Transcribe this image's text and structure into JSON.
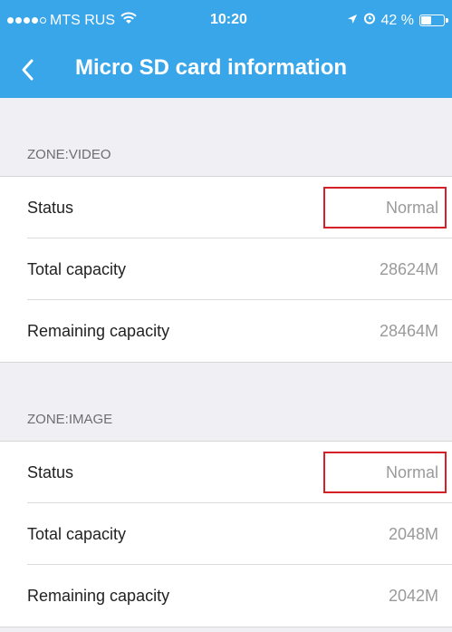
{
  "status_bar": {
    "carrier": "MTS RUS",
    "time": "10:20",
    "battery": "42 %",
    "battery_level": 0.42
  },
  "nav": {
    "title": "Micro SD card information"
  },
  "sections": [
    {
      "header": "ZONE:VIDEO",
      "rows": [
        {
          "label": "Status",
          "value": "Normal"
        },
        {
          "label": "Total capacity",
          "value": "28624M"
        },
        {
          "label": "Remaining capacity",
          "value": "28464M"
        }
      ]
    },
    {
      "header": "ZONE:IMAGE",
      "rows": [
        {
          "label": "Status",
          "value": "Normal"
        },
        {
          "label": "Total capacity",
          "value": "2048M"
        },
        {
          "label": "Remaining capacity",
          "value": "2042M"
        }
      ]
    }
  ],
  "colors": {
    "accent": "#3aa6ea",
    "highlight": "#d62028"
  }
}
